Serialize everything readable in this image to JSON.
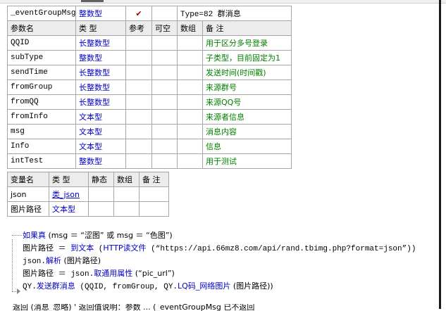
{
  "event_table": {
    "event_row": {
      "name": "_eventGroupMsg",
      "type": "整数型",
      "public_mark": "✔",
      "note": "Type=82 群消息"
    },
    "headers": [
      "参数名",
      "类 型",
      "参考",
      "可空",
      "数组",
      "备 注"
    ],
    "params": [
      {
        "name": "QQID",
        "type": "长整数型",
        "note": "用于区分多号登录"
      },
      {
        "name": "subType",
        "type": "整数型",
        "note": "子类型，目前固定为1"
      },
      {
        "name": "sendTime",
        "type": "长整数型",
        "note": "发送时间(时间戳)"
      },
      {
        "name": "fromGroup",
        "type": "长整数型",
        "note": "来源群号"
      },
      {
        "name": "fromQQ",
        "type": "长整数型",
        "note": "来源QQ号"
      },
      {
        "name": "fromInfo",
        "type": "文本型",
        "note": "来源者信息"
      },
      {
        "name": "msg",
        "type": "文本型",
        "note": "消息内容"
      },
      {
        "name": "Info",
        "type": "文本型",
        "note": "信息"
      },
      {
        "name": "intTest",
        "type": "整数型",
        "note": "用于测试"
      }
    ]
  },
  "var_table": {
    "headers": [
      "变量名",
      "类 型",
      "静态",
      "数组",
      "备 注"
    ],
    "rows": [
      {
        "name": "json",
        "type": "类_json"
      },
      {
        "name": "图片路径",
        "type": "文本型"
      }
    ]
  },
  "code": {
    "line1": {
      "kw": "如果真",
      "rest": " (msg ＝ “涩图” 或 msg ＝ “色图”)"
    },
    "line2": {
      "var": "图片路径",
      "eq": " ＝ ",
      "fn": "到文本",
      "mid": " (",
      "fn2": "HTTP读文件",
      "rest": " (“https://api.66mz8.com/api/rand.tbimg.php?format=json”))"
    },
    "line3": {
      "obj": "json.",
      "fn": "解析",
      "rest": " (图片路径)"
    },
    "line4": {
      "var": "图片路径",
      "eq": " ＝ json.",
      "fn": "取通用属性",
      "rest": " (“pic_url”)"
    },
    "line5": {
      "obj": "QY.",
      "fn": "发送群消息",
      "rest": " (QQID, fromGroup, QY.",
      "fn2": "LQ码_网络图片",
      "rest2": " (图片路径))"
    },
    "cut": "返回 (消息_忽略) ' 返回值说明：参数 ... (_eventGroupMsg 已不返回"
  }
}
